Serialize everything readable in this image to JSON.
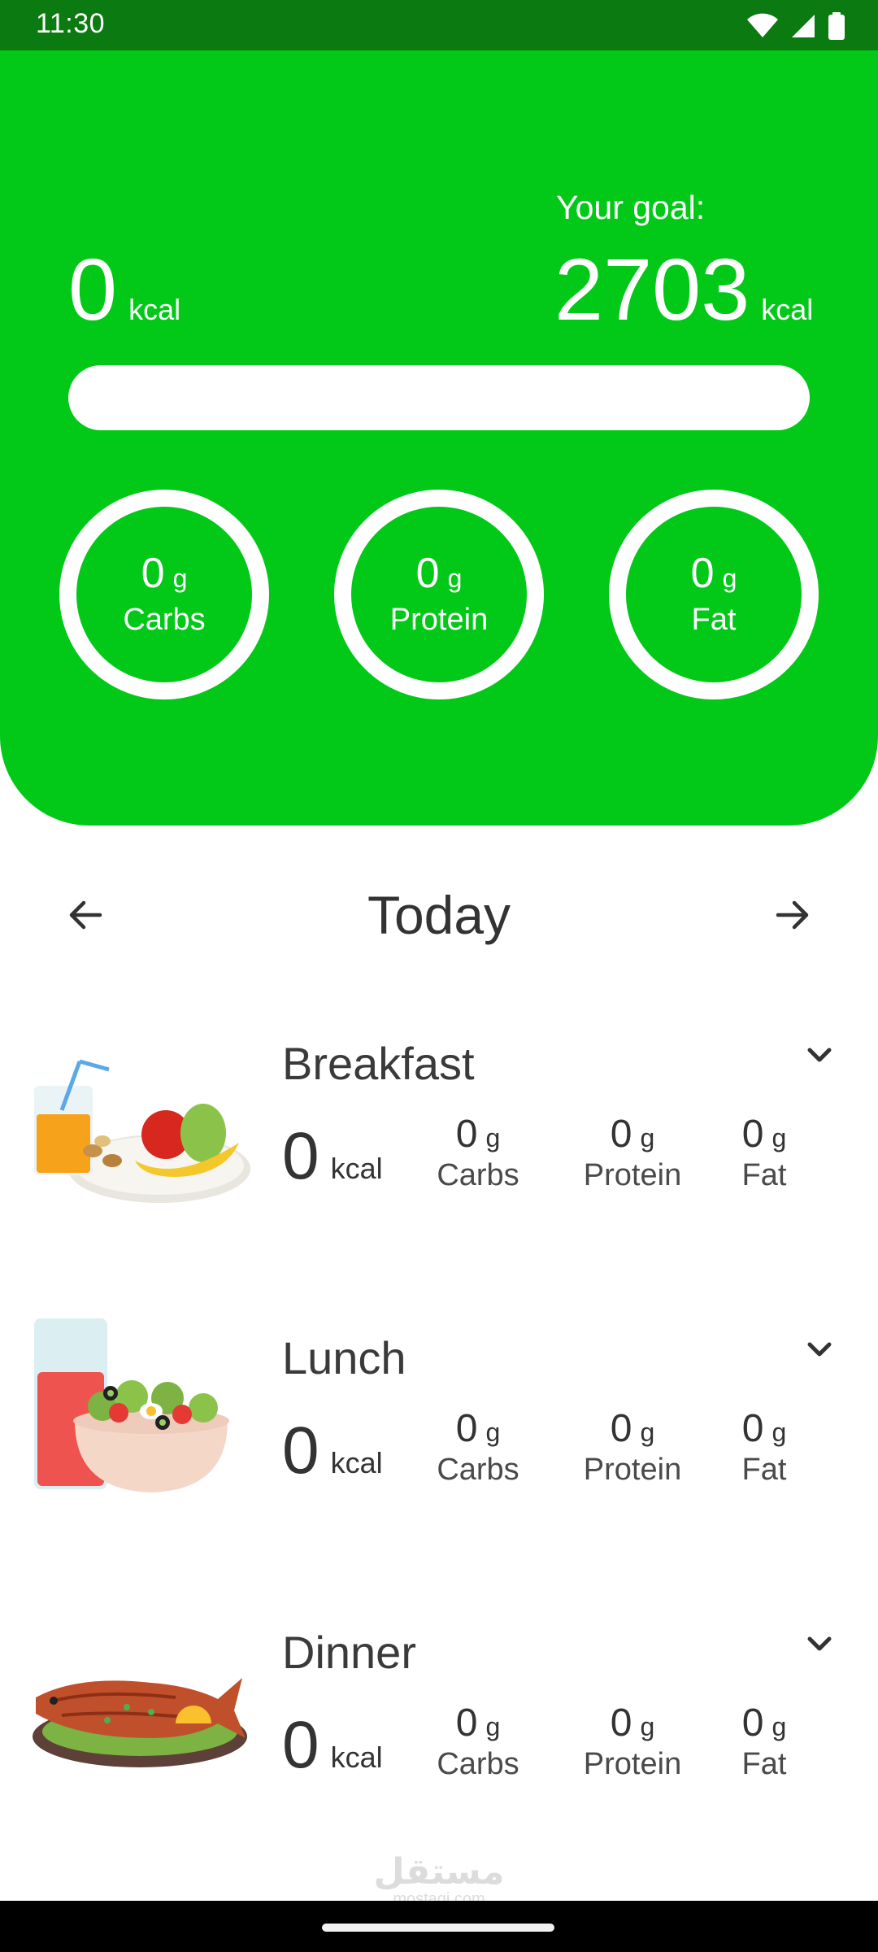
{
  "status_bar": {
    "time": "11:30"
  },
  "summary": {
    "consumed_value": "0",
    "consumed_unit": "kcal",
    "goal_label": "Your goal:",
    "goal_value": "2703",
    "goal_unit": "kcal",
    "progress_fraction": 0
  },
  "macros": [
    {
      "value": "0",
      "unit": "g",
      "label": "Carbs"
    },
    {
      "value": "0",
      "unit": "g",
      "label": "Protein"
    },
    {
      "value": "0",
      "unit": "g",
      "label": "Fat"
    }
  ],
  "day_nav": {
    "title": "Today"
  },
  "meals": [
    {
      "name": "Breakfast",
      "kcal": "0",
      "kcal_unit": "kcal",
      "macros": [
        {
          "value": "0",
          "unit": "g",
          "label": "Carbs"
        },
        {
          "value": "0",
          "unit": "g",
          "label": "Protein"
        },
        {
          "value": "0",
          "unit": "g",
          "label": "Fat"
        }
      ]
    },
    {
      "name": "Lunch",
      "kcal": "0",
      "kcal_unit": "kcal",
      "macros": [
        {
          "value": "0",
          "unit": "g",
          "label": "Carbs"
        },
        {
          "value": "0",
          "unit": "g",
          "label": "Protein"
        },
        {
          "value": "0",
          "unit": "g",
          "label": "Fat"
        }
      ]
    },
    {
      "name": "Dinner",
      "kcal": "0",
      "kcal_unit": "kcal",
      "macros": [
        {
          "value": "0",
          "unit": "g",
          "label": "Carbs"
        },
        {
          "value": "0",
          "unit": "g",
          "label": "Protein"
        },
        {
          "value": "0",
          "unit": "g",
          "label": "Fat"
        }
      ]
    }
  ],
  "watermark": {
    "logo": "مستقل",
    "sub": "mostaqi.com"
  },
  "colors": {
    "brand_green": "#02c918",
    "status_green": "#0b7a10",
    "text_dark": "#333333"
  },
  "icons": {
    "status": [
      "wifi-icon",
      "signal-icon",
      "battery-icon"
    ],
    "nav": [
      "arrow-left-icon",
      "arrow-right-icon"
    ],
    "meal": [
      "chevron-down-icon"
    ]
  }
}
